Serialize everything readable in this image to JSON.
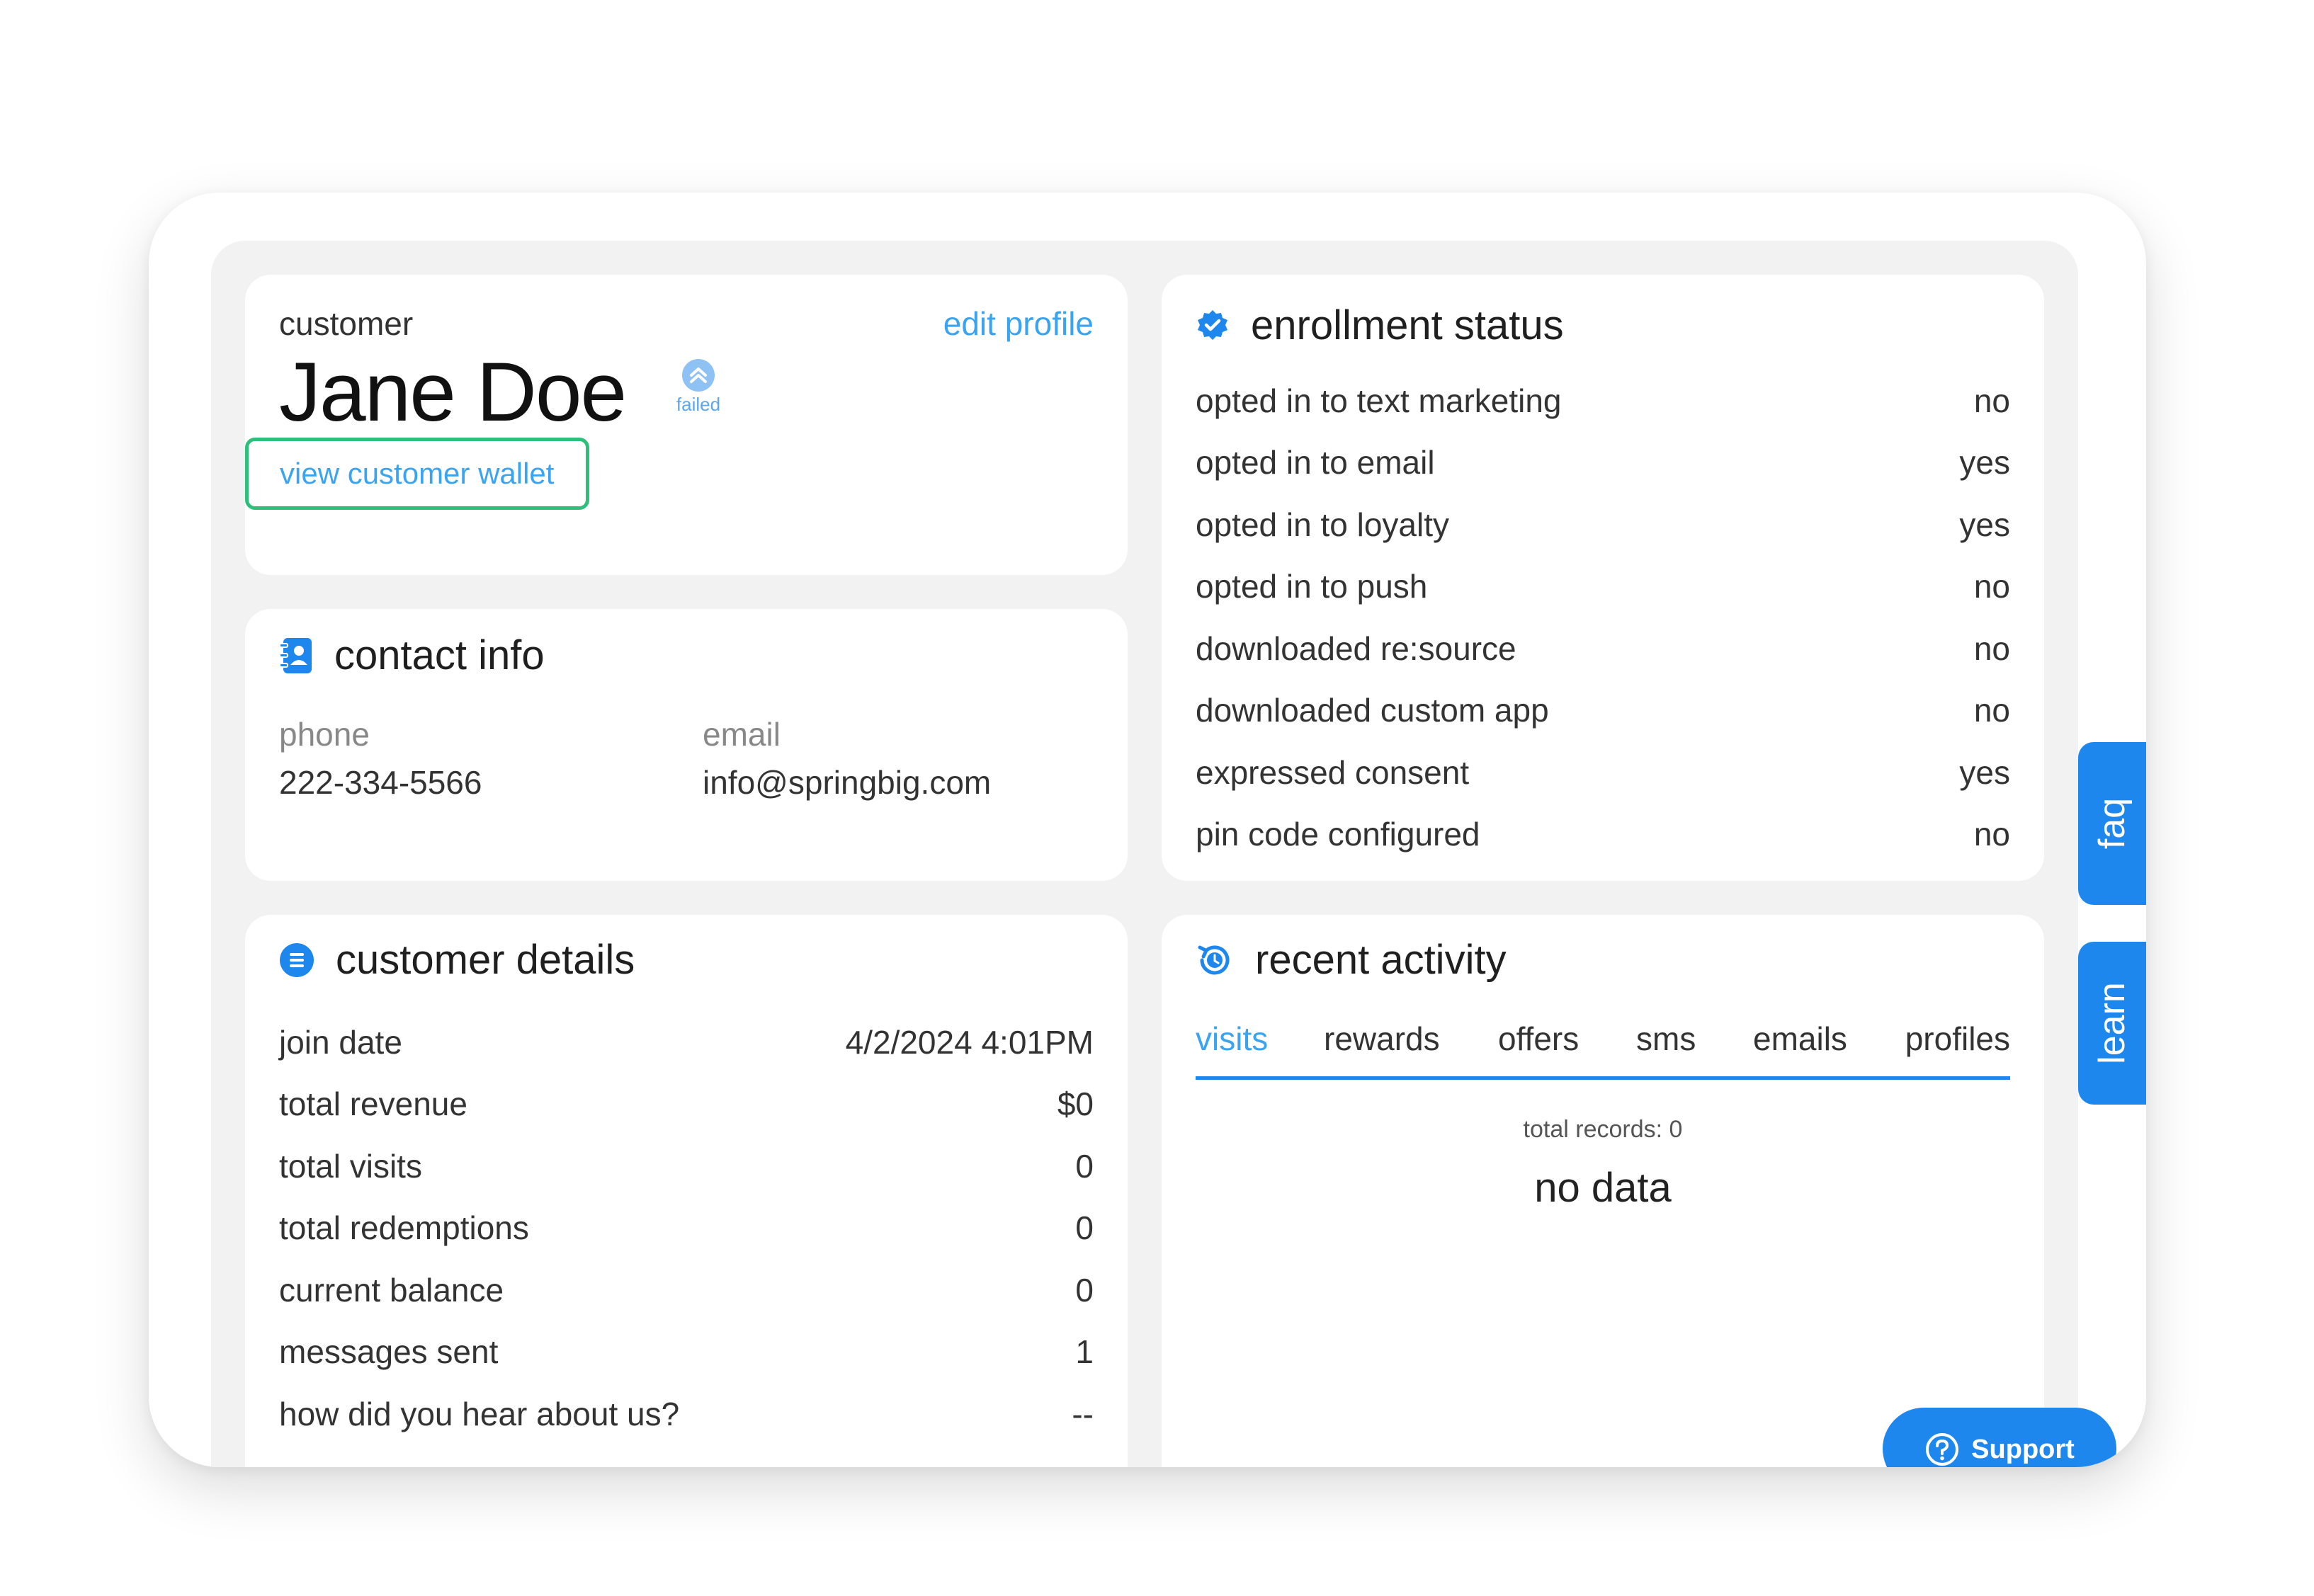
{
  "customer": {
    "label": "customer",
    "name": "Jane Doe",
    "edit_profile": "edit profile",
    "status_badge": "failed",
    "wallet_button": "view customer wallet"
  },
  "contact": {
    "title": "contact info",
    "phone_label": "phone",
    "phone_value": "222-334-5566",
    "email_label": "email",
    "email_value": "info@springbig.com"
  },
  "details": {
    "title": "customer details",
    "rows": [
      {
        "label": "join date",
        "value": "4/2/2024 4:01PM"
      },
      {
        "label": "total revenue",
        "value": "$0"
      },
      {
        "label": "total visits",
        "value": "0"
      },
      {
        "label": "total redemptions",
        "value": "0"
      },
      {
        "label": "current balance",
        "value": "0"
      },
      {
        "label": "messages sent",
        "value": "1"
      },
      {
        "label": "how did you hear about us?",
        "value": "--"
      }
    ]
  },
  "enrollment": {
    "title": "enrollment status",
    "rows": [
      {
        "label": "opted in to text marketing",
        "value": "no"
      },
      {
        "label": "opted in to email",
        "value": "yes"
      },
      {
        "label": "opted in to loyalty",
        "value": "yes"
      },
      {
        "label": "opted in to push",
        "value": "no"
      },
      {
        "label": "downloaded re:source",
        "value": "no"
      },
      {
        "label": "downloaded custom app",
        "value": "no"
      },
      {
        "label": "expressed consent",
        "value": "yes"
      },
      {
        "label": "pin code configured",
        "value": "no"
      }
    ]
  },
  "activity": {
    "title": "recent activity",
    "tabs": [
      "visits",
      "rewards",
      "offers",
      "sms",
      "emails",
      "profiles"
    ],
    "active_tab": "visits",
    "total_records": "total records: 0",
    "empty": "no data"
  },
  "side_tabs": {
    "faq": "faq",
    "learn": "learn"
  },
  "support": {
    "label": "Support"
  },
  "colors": {
    "accent": "#1e87ee",
    "link": "#3ba4f1",
    "wallet_border": "#2ebf7a",
    "card_bg": "#ffffff",
    "panel_bg": "#f2f2f2"
  }
}
